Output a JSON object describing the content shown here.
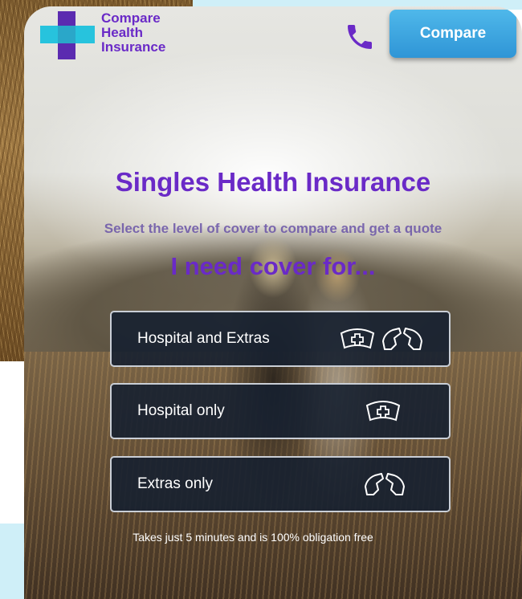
{
  "header": {
    "logo_line1": "Compare",
    "logo_line2": "Health",
    "logo_line3": "Insurance",
    "compare_button": "Compare"
  },
  "hero": {
    "title": "Singles Health Insurance",
    "subtitle": "Select the level of cover to compare and get a quote",
    "cover_heading": "I need cover for..."
  },
  "options": [
    {
      "label": "Hospital and Extras",
      "icons": [
        "nurse-cap-icon",
        "hands-icon"
      ]
    },
    {
      "label": "Hospital only",
      "icons": [
        "nurse-cap-icon"
      ]
    },
    {
      "label": "Extras only",
      "icons": [
        "hands-icon"
      ]
    }
  ],
  "footer_note": "Takes just 5 minutes and is 100% obligation free",
  "colors": {
    "brand_purple": "#6a2ac7",
    "logo_cross_cyan": "#27c3dd",
    "button_blue": "#2f95d6",
    "option_bg": "#162030"
  }
}
